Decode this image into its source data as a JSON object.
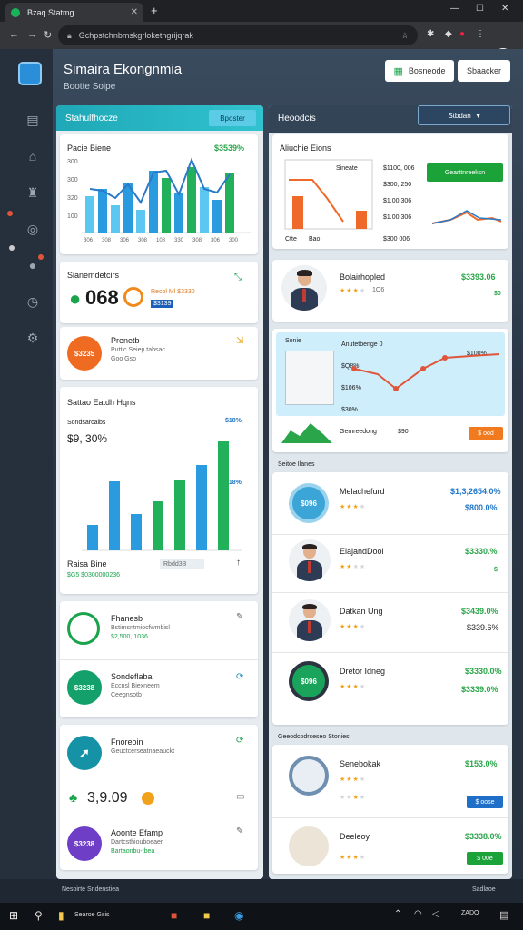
{
  "browser": {
    "tab_title": "Bzaq Statmg",
    "url": "Gchpstchnbmskgrloketngrijqrak"
  },
  "header": {
    "title": "Simaira Ekongnmia",
    "subtitle": "Bootte Soipe",
    "btn_primary": "Bosneode",
    "btn_secondary": "Sbaacker"
  },
  "left": {
    "head": "Stahulfhocze",
    "head_pill": "Bposter",
    "chart1": {
      "title": "Pacie Biene",
      "value": "$3539%",
      "ticks": [
        "300",
        "300",
        "320",
        "100"
      ],
      "xlabels": [
        "306",
        "308",
        "306",
        "308",
        "108",
        "330",
        "308",
        "306",
        "300"
      ]
    },
    "kpi1": {
      "title": "Sianemdetcirs",
      "big": "068",
      "tag1": "Recol Ml $3330",
      "tag2": "$3139"
    },
    "promo": {
      "circle": "$3235",
      "title": "Prenetb",
      "line1": "Puttic Seiep tabsac",
      "line2": "Goo Gso"
    },
    "chart2": {
      "title": "Sattao Eatdh Hqns",
      "sub": "Sondsarcaibs",
      "big": "$9, 30%",
      "val1": "$18%",
      "val2": "$18%",
      "foot_title": "Raisa Bine",
      "foot_sub": "$G5 $0300000236",
      "legend": "Rbdd3B"
    },
    "list": [
      {
        "title": "Fhanesb",
        "line1": "Bstimsntmiocfwmbisl",
        "line2": "$2,500, 1036"
      },
      {
        "title": "Sondeflaba",
        "line1": "Eccnsl Biexneem",
        "line2": "Ceegnsotb",
        "circle": "$3238"
      },
      {
        "title": "Fnoreoin",
        "line1": "Geuctcerseatnaeauckt",
        "line2": "3,9.09",
        "circle": ""
      },
      {
        "title": "Aoonte Efamp",
        "line1": "Dartcsthiouboeaer",
        "line2": "Bartaonbu-tbea",
        "circle": "$3238"
      }
    ]
  },
  "right": {
    "head": "Heoodcis",
    "head_pill": "Stbdan",
    "chart3": {
      "title": "Aliuchie Eions",
      "legend": "Sineate",
      "v1": "$1100, 006",
      "v2": "$300, 250",
      "v3": "$1.00 306",
      "v4": "$1.00 306",
      "foot1": "Ctte",
      "foot2": "Bao",
      "foot3": "$300 006",
      "btn": "Gearttnreeksn"
    },
    "products": [
      {
        "title": "Bolairhopled",
        "price": "$3393.06",
        "sub": "1O6",
        "stars": 3
      },
      {
        "title": "Melachefurd",
        "price": "$1,3,2654,0%",
        "sub2": "$800.0%",
        "stars": 3,
        "circle": "$096"
      },
      {
        "title": "ElajandDool",
        "price": "$3330.%",
        "sub": "1O6",
        "stars": 2
      },
      {
        "title": "Datkan Ung",
        "price": "$3439.0%",
        "sub2": "$339.6%",
        "stars": 3
      },
      {
        "title": "Dretor Idneg",
        "price": "$3330.0%",
        "sub2": "$3339.0%",
        "stars": 3,
        "circle": "$096"
      }
    ],
    "map": {
      "title": "Sonie",
      "label": "Anutetbenge 0",
      "v1": "$Q8%",
      "v2": "$106%",
      "v3": "$30%",
      "v4": "$100%",
      "foot": "Gemreedong",
      "foot2": "$90",
      "btn": "$ ood"
    },
    "section1": "Seitoe Ilanes",
    "section2": "Geeodcodrceseo Stonies",
    "bottom_products": [
      {
        "title": "Senebokak",
        "price": "$153.0%",
        "stars": 3,
        "btn": "$ oose"
      },
      {
        "title": "Deeleoy",
        "price": "$3338.0%",
        "stars": 3,
        "btn": "$ 00e"
      }
    ]
  },
  "footer": {
    "left": "Nesoirte Sndenstiea",
    "right": "Sadlaoe"
  },
  "taskbar": {
    "app": "Searoe Gsis",
    "time": "ZADO"
  }
}
